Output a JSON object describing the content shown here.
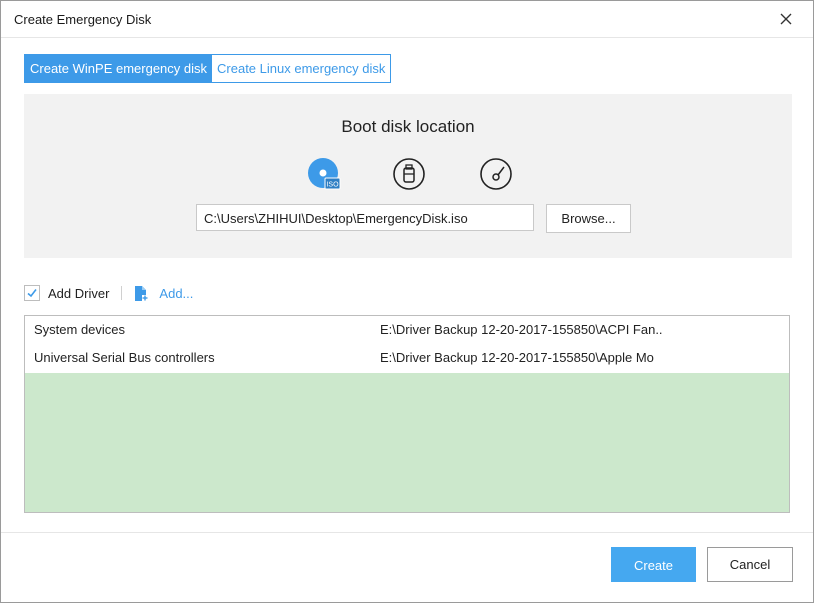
{
  "window": {
    "title": "Create Emergency Disk"
  },
  "tabs": [
    {
      "label": "Create WinPE emergency disk",
      "active": true
    },
    {
      "label": "Create Linux emergency disk",
      "active": false
    }
  ],
  "boot": {
    "title": "Boot disk location",
    "media_options": [
      {
        "icon": "iso-disc-icon",
        "badge": "ISO",
        "selected": true
      },
      {
        "icon": "usb-drive-icon",
        "selected": false
      },
      {
        "icon": "cd-dvd-icon",
        "selected": false
      }
    ],
    "path_value": "C:\\Users\\ZHIHUI\\Desktop\\EmergencyDisk.iso",
    "browse_label": "Browse..."
  },
  "drivers": {
    "add_driver_label": "Add Driver",
    "add_driver_checked": true,
    "add_link_label": "Add...",
    "items": [
      {
        "name": "System devices",
        "path": "E:\\Driver Backup 12-20-2017-155850\\ACPI Fan.."
      },
      {
        "name": "Universal Serial Bus controllers",
        "path": "E:\\Driver Backup 12-20-2017-155850\\Apple Mo"
      }
    ]
  },
  "footer": {
    "create_label": "Create",
    "cancel_label": "Cancel"
  },
  "colors": {
    "accent": "#3d9ae8",
    "list_fill": "#cce8cc",
    "panel_bg": "#f2f2f2"
  }
}
